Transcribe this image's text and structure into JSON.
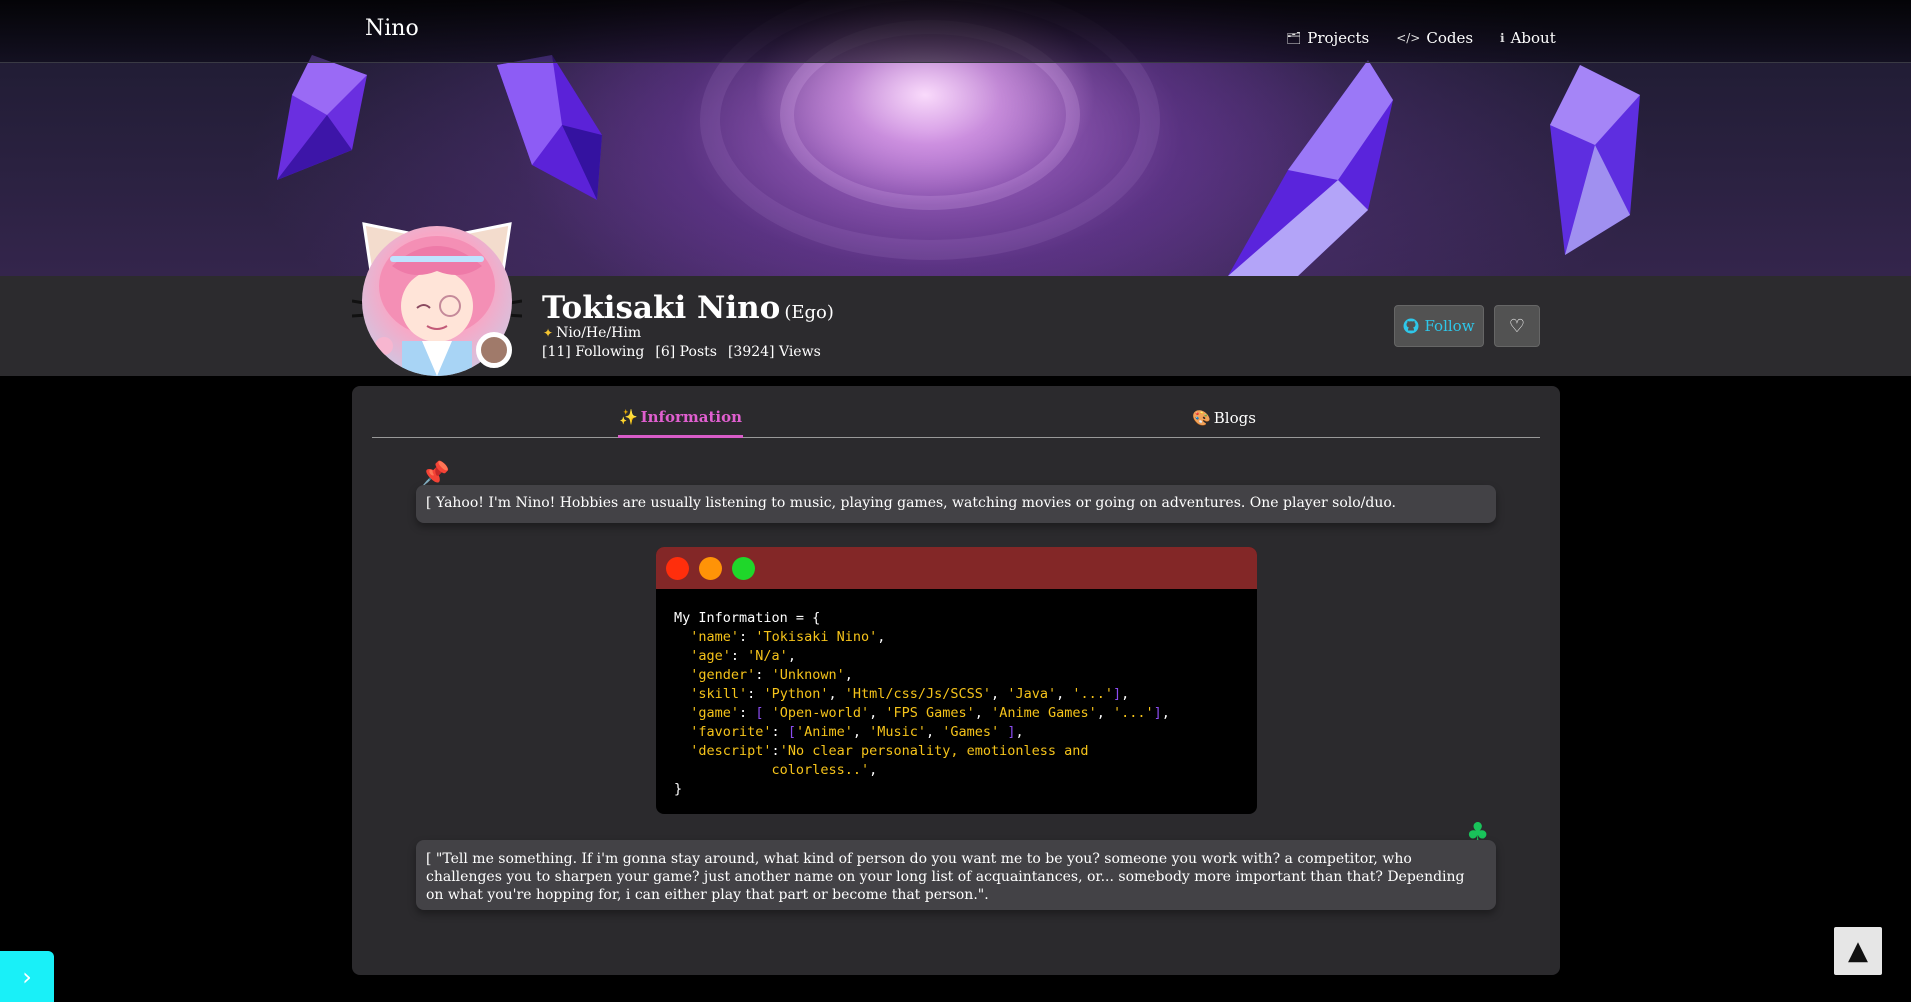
{
  "navbar": {
    "brand": "Nino",
    "links": [
      {
        "label": "Projects",
        "icon": "folder-icon"
      },
      {
        "label": "Codes",
        "icon": "code-icon"
      },
      {
        "label": "About",
        "icon": "info-icon"
      }
    ]
  },
  "profile": {
    "name": "Tokisaki Nino",
    "nickname": "(Ego)",
    "pronouns": "Nio/He/Him",
    "stats": {
      "following": "[11] Following",
      "posts": "[6] Posts",
      "views": "[3924] Views"
    },
    "follow_label": "Follow",
    "status_color": "#a07a6a"
  },
  "tabs": [
    {
      "label": "Information",
      "icon": "sparkles-icon",
      "active": true
    },
    {
      "label": "Blogs",
      "icon": "palette-icon",
      "active": false
    }
  ],
  "notes": {
    "intro": "[ Yahoo! I'm Nino! Hobbies are usually listening to music, playing games, watching movies or going on adventures. One player solo/duo.",
    "quote": "[ \"Tell me something. If i'm gonna stay around, what kind of person do you want me to be you? someone you work with? a competitor, who challenges you to sharpen your game? just another name on your long list of acquaintances, or... somebody more important than that? Depending on what you're hopping for, i can either play that part or become that person.\"."
  },
  "code": {
    "header": "My Information = {",
    "name": "'Tokisaki Nino'",
    "age": "'N/a'",
    "gender": "'Unknown'",
    "skill_1": "'Python'",
    "skill_2": "'Html/css/Js/SCSS'",
    "skill_3": "'Java'",
    "skill_4": "'...'",
    "game_1": "'Open-world'",
    "game_2": "'FPS Games'",
    "game_3": "'Anime Games'",
    "game_4": "'...'",
    "fav_1": "'Anime'",
    "fav_2": "'Music'",
    "fav_3": "'Games'",
    "descript_1": "'No clear personality, emotionless and",
    "descript_2": "colorless..'",
    "footer": "}"
  },
  "colors": {
    "accent_pink": "#d85cc8",
    "follow_text": "#2ec7ea",
    "code_titlebar": "#832727",
    "code_string": "#f5c31a",
    "code_bracket": "#8b4cf0",
    "side_toggle": "#19f0f8"
  }
}
